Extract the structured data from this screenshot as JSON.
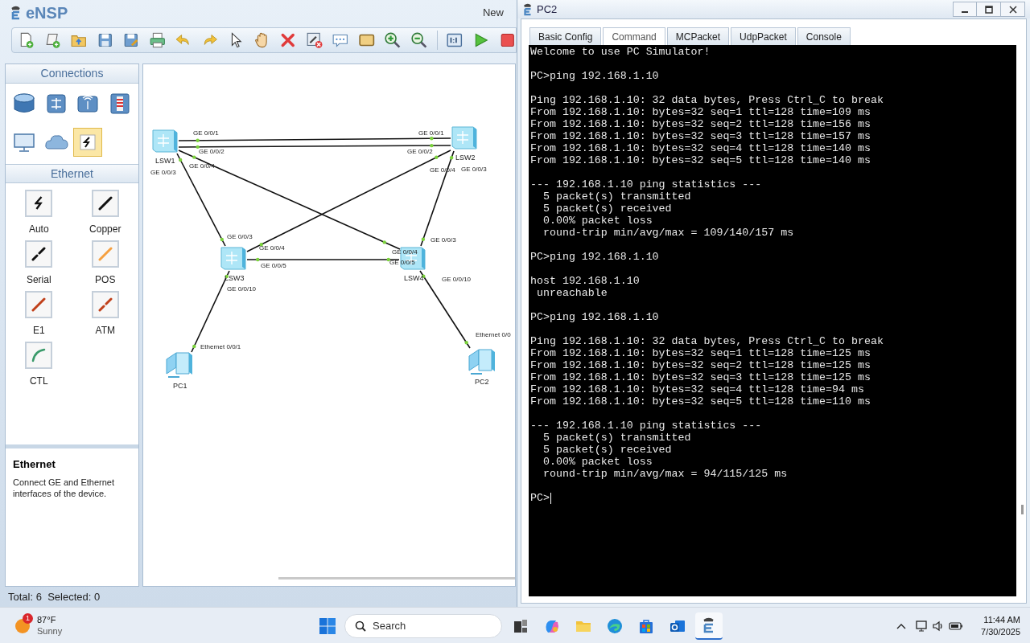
{
  "main_window": {
    "title": "eNSP",
    "title_fragment": "New"
  },
  "sidebar": {
    "connections_header": "Connections",
    "device_categories": [
      {
        "selected": false
      },
      {
        "selected": false
      },
      {
        "selected": false
      },
      {
        "selected": false
      },
      {
        "selected": false
      },
      {
        "selected": false
      },
      {
        "selected": true
      }
    ],
    "cables_header": "Ethernet",
    "cables": [
      {
        "label": "Auto"
      },
      {
        "label": "Copper"
      },
      {
        "label": "Serial"
      },
      {
        "label": "POS"
      },
      {
        "label": "E1"
      },
      {
        "label": "ATM"
      },
      {
        "label": "CTL"
      }
    ],
    "info": {
      "title": "Ethernet",
      "description": "Connect GE and Ethernet interfaces of the device."
    }
  },
  "topology": {
    "devices": [
      {
        "name": "LSW1",
        "kind": "switch"
      },
      {
        "name": "LSW2",
        "kind": "switch"
      },
      {
        "name": "LSW3",
        "kind": "switch"
      },
      {
        "name": "LSW4",
        "kind": "switch"
      },
      {
        "name": "PC1",
        "kind": "pc"
      },
      {
        "name": "PC2",
        "kind": "pc"
      }
    ],
    "links": [
      {
        "port_a": "GE 0/0/1",
        "port_b": "GE 0/0/1"
      },
      {
        "port_a": "GE 0/0/2",
        "port_b": "GE 0/0/2"
      },
      {
        "port_a": "GE 0/0/4",
        "port_b": "GE 0/0/4"
      },
      {
        "port_a": "GE 0/0/3",
        "port_b": "GE 0/0/3"
      },
      {
        "port_a": "GE 0/0/4",
        "port_b": "GE 0/0/4"
      },
      {
        "port_a": "GE 0/0/3",
        "port_b": "GE 0/0/3"
      },
      {
        "port_a": "GE 0/0/5",
        "port_b": "GE 0/0/5"
      },
      {
        "port_a": "GE 0/0/10",
        "port_b": "Ethernet 0/0/1"
      },
      {
        "port_a": "GE 0/0/10",
        "port_b": "Ethernet 0/0"
      }
    ]
  },
  "status_bar": "Total: 6  Selected: 0",
  "pc_window": {
    "title": "PC2",
    "tabs": [
      {
        "label": "Basic Config",
        "selected": false
      },
      {
        "label": "Command",
        "selected": true
      },
      {
        "label": "MCPacket",
        "selected": false
      },
      {
        "label": "UdpPacket",
        "selected": false
      },
      {
        "label": "Console",
        "selected": false
      }
    ],
    "terminal": {
      "paragraphs": [
        [
          "Welcome to use PC Simulator!"
        ],
        [
          "PC>ping 192.168.1.10"
        ],
        [
          "Ping 192.168.1.10: 32 data bytes, Press Ctrl_C to break",
          "From 192.168.1.10: bytes=32 seq=1 ttl=128 time=109 ms",
          "From 192.168.1.10: bytes=32 seq=2 ttl=128 time=156 ms",
          "From 192.168.1.10: bytes=32 seq=3 ttl=128 time=157 ms",
          "From 192.168.1.10: bytes=32 seq=4 ttl=128 time=140 ms",
          "From 192.168.1.10: bytes=32 seq=5 ttl=128 time=140 ms"
        ],
        [
          "--- 192.168.1.10 ping statistics ---",
          "  5 packet(s) transmitted",
          "  5 packet(s) received",
          "  0.00% packet loss",
          "  round-trip min/avg/max = 109/140/157 ms"
        ],
        [
          "PC>ping 192.168.1.10"
        ],
        [
          "host 192.168.1.10",
          " unreachable"
        ],
        [
          "PC>ping 192.168.1.10"
        ],
        [
          "Ping 192.168.1.10: 32 data bytes, Press Ctrl_C to break",
          "From 192.168.1.10: bytes=32 seq=1 ttl=128 time=125 ms",
          "From 192.168.1.10: bytes=32 seq=2 ttl=128 time=125 ms",
          "From 192.168.1.10: bytes=32 seq=3 ttl=128 time=125 ms",
          "From 192.168.1.10: bytes=32 seq=4 ttl=128 time=94 ms",
          "From 192.168.1.10: bytes=32 seq=5 ttl=128 time=110 ms"
        ],
        [
          "--- 192.168.1.10 ping statistics ---",
          "  5 packet(s) transmitted",
          "  5 packet(s) received",
          "  0.00% packet loss",
          "  round-trip min/avg/max = 94/115/125 ms"
        ]
      ],
      "prompt": "PC>"
    }
  },
  "taskbar": {
    "weather": {
      "temperature": "87°F",
      "condition": "Sunny",
      "badge": "1"
    },
    "search_placeholder": "Search",
    "time": "11:44 AM",
    "date": "7/30/2025"
  }
}
